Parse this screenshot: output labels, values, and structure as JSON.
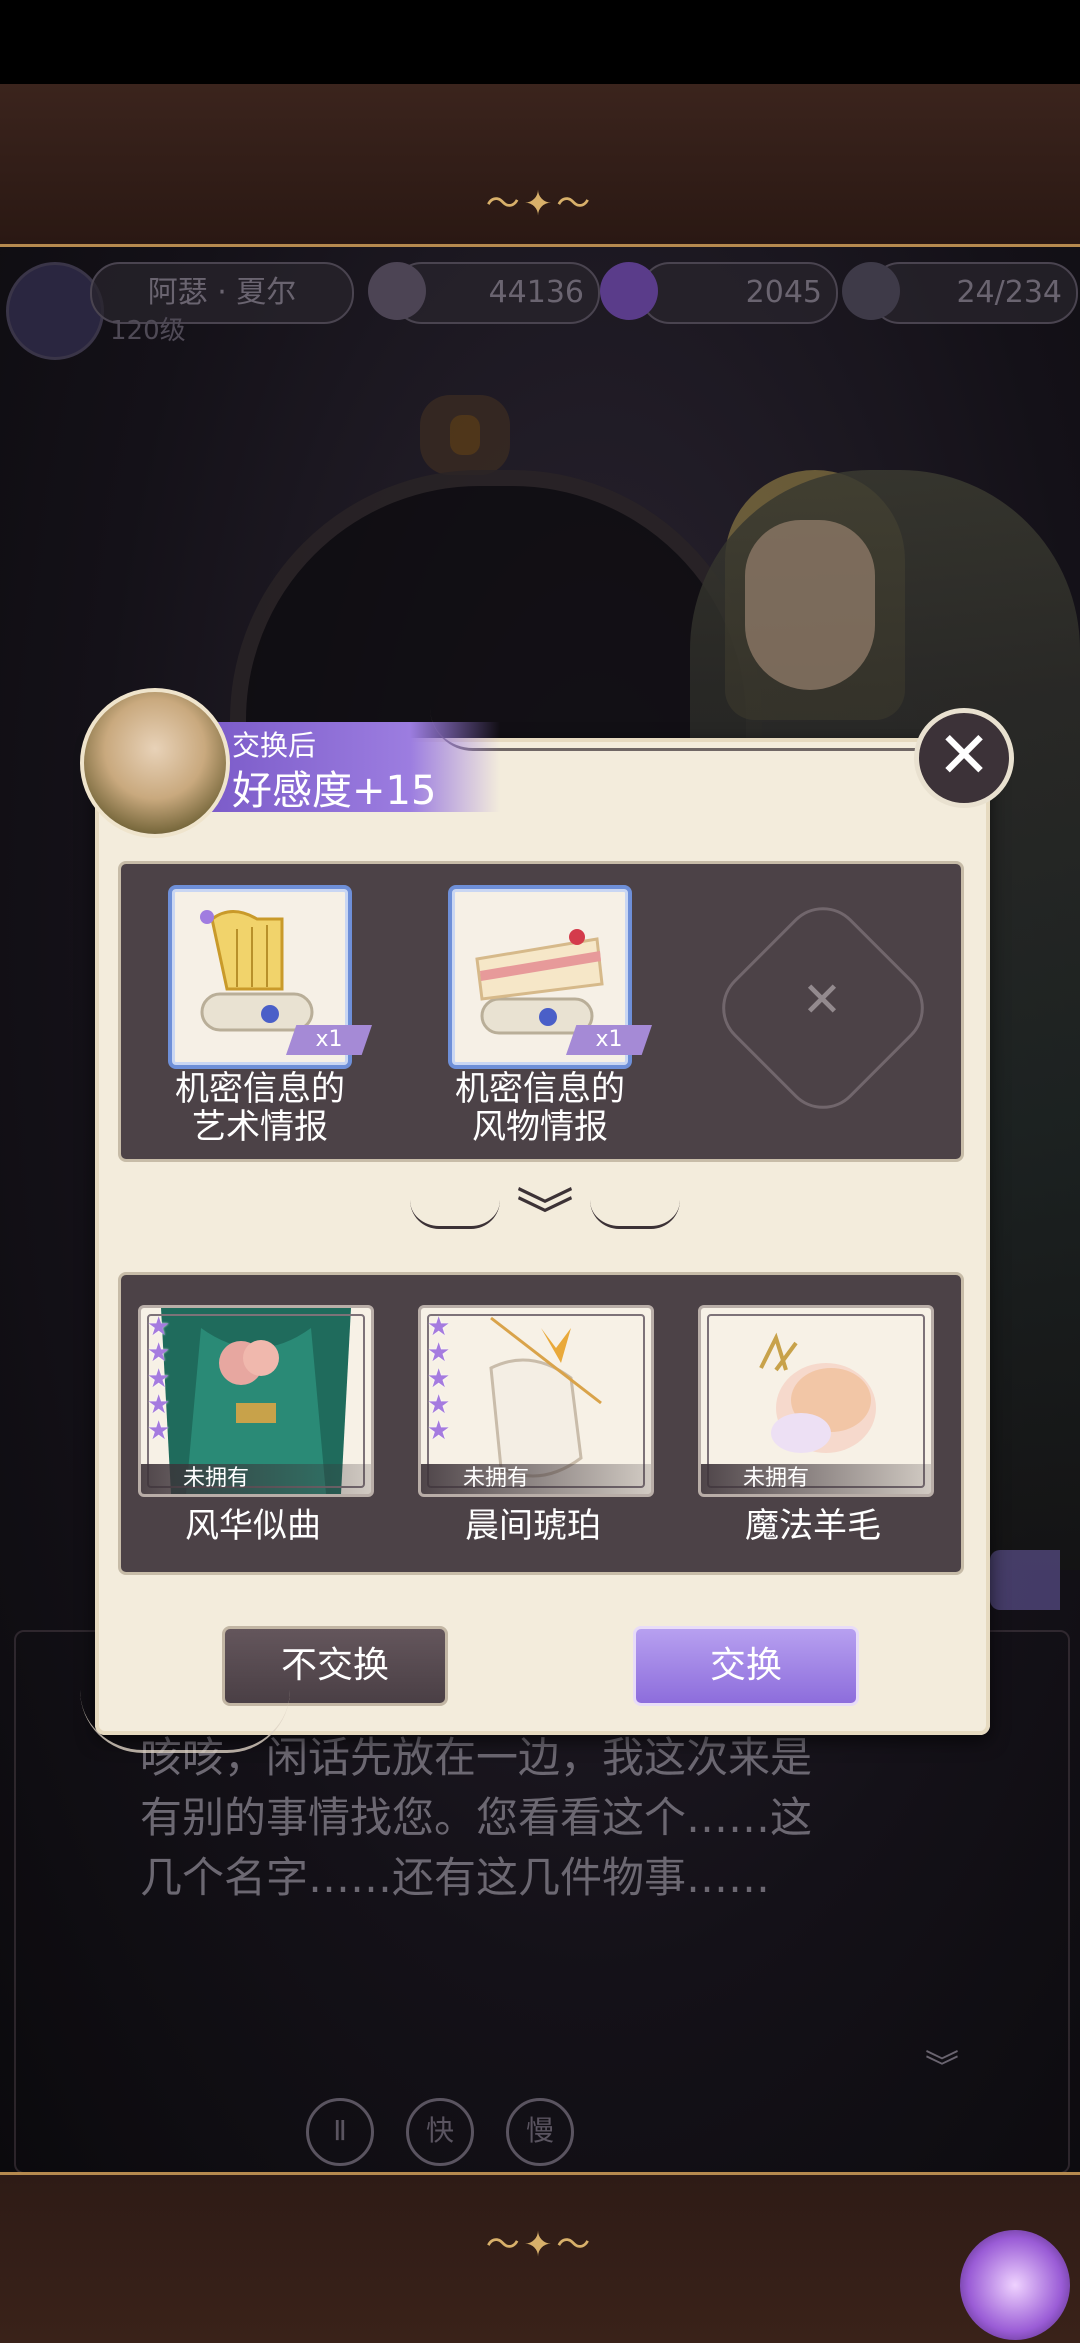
{
  "hud": {
    "player_name": "阿瑟 · 夏尔",
    "player_level": "120级",
    "gold": "44136",
    "gems": "2045",
    "stamina": "24/234"
  },
  "dialog": {
    "text": "咳咳，闲话先放在一边，我这次来是\n有别的事情找您。您看看这个……这\n几个名字……还有这几件物事……"
  },
  "controls": {
    "pause": "Ⅱ",
    "fast": "快",
    "slow": "慢"
  },
  "modal": {
    "header_label": "交换后",
    "header_value": "好感度+15",
    "close_symbol": "✕",
    "cost_items": [
      {
        "label": "机密信息的\n艺术情报",
        "qty": "x1",
        "icon": "harp-scroll-icon"
      },
      {
        "label": "机密信息的\n风物情报",
        "qty": "x1",
        "icon": "cake-scroll-icon"
      }
    ],
    "divider_symbol": "︾",
    "reward_items": [
      {
        "label": "风华似曲",
        "status": "未拥有",
        "stars": "★★★★★",
        "icon": "green-dress-icon"
      },
      {
        "label": "晨间琥珀",
        "status": "未拥有",
        "stars": "★★★★★",
        "icon": "glove-bracelet-icon"
      },
      {
        "label": "魔法羊毛",
        "status": "未拥有",
        "stars": "",
        "icon": "wool-ball-icon"
      }
    ],
    "buttons": {
      "decline": "不交换",
      "confirm": "交换"
    }
  },
  "colors": {
    "accent_purple": "#8d6ddc",
    "panel_dark": "#4c4247",
    "modal_bg": "#f3ecdc"
  }
}
